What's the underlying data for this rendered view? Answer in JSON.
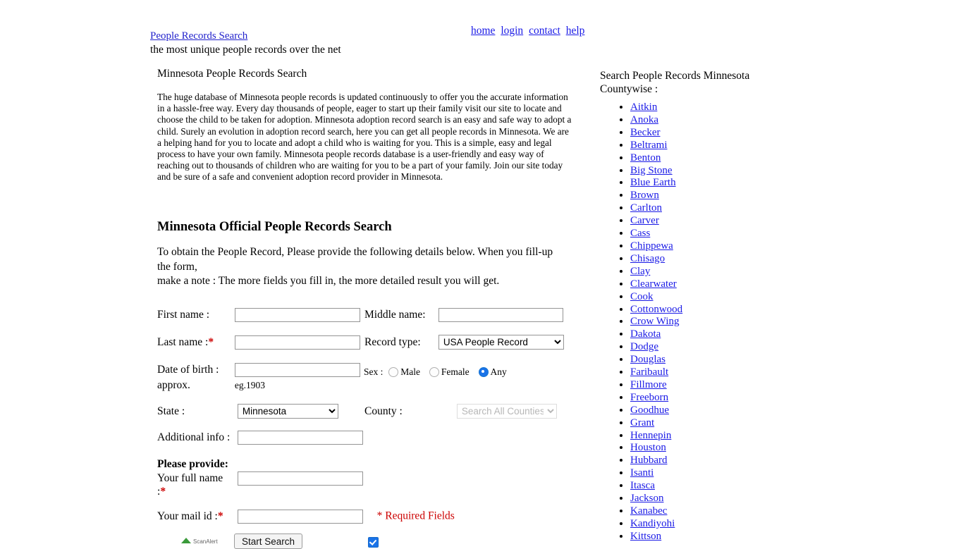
{
  "header": {
    "brand": "People Records Search",
    "tagline": "the most unique people records over the net",
    "nav": [
      {
        "label": "home"
      },
      {
        "label": "login"
      },
      {
        "label": "contact"
      },
      {
        "label": "help"
      }
    ]
  },
  "main": {
    "page_heading": "Minnesota People Records Search",
    "intro": "The huge database of Minnesota people records is updated continuously to offer you the accurate information in a hassle-free way. Every day thousands of people, eager to start up their family visit our site to locate and choose the child to be taken for adoption. Minnesota adoption record search is an easy and safe way to adopt a child. Surely an evolution in adoption record search, here you can get all people records in Minnesota. We are a helping hand for you to locate and adopt a child who is waiting for you. This is a simple, easy and legal process to have your own family. Minnesota people records database is a user-friendly and easy way of reaching out to thousands of children who are waiting for you to be a part of your family. Join our site today and be sure of a safe and convenient adoption record provider in Minnesota.",
    "form_heading": "Minnesota Official People Records Search",
    "instructions_line1": "To obtain the People Record, Please provide the following details below. When you fill-up the form,",
    "instructions_line2": "make a note : The more fields you fill in, the more detailed result you will get."
  },
  "form": {
    "first_name_label": "First name :",
    "first_name_value": "",
    "middle_name_label": "Middle name:",
    "middle_name_value": "",
    "last_name_label": "Last name :",
    "last_name_value": "",
    "record_type_label": "Record type:",
    "record_type_value": "USA People Record",
    "record_type_options": [
      "USA People Record"
    ],
    "dob_label": "Date of birth :",
    "dob_label_line2": "approx.",
    "dob_value": "",
    "dob_hint": "eg.1903",
    "sex_label": "Sex :",
    "sex_options": [
      {
        "label": "Male",
        "selected": false
      },
      {
        "label": "Female",
        "selected": false
      },
      {
        "label": "Any",
        "selected": true
      }
    ],
    "state_label": "State :",
    "state_value": "Minnesota",
    "state_options": [
      "Minnesota"
    ],
    "county_label": "County :",
    "county_value": "Search All Counties",
    "county_options": [
      "Search All Counties"
    ],
    "county_disabled": true,
    "additional_info_label": "Additional info :",
    "additional_info_value": "",
    "please_provide_label": "Please provide:",
    "full_name_label": "Your full name",
    "full_name_label_line2": ":",
    "full_name_value": "",
    "mail_id_label": "Your mail id :",
    "mail_id_value": "",
    "required_note": "* Required Fields",
    "required_marker": "*",
    "submit_label": "Start Search",
    "scanalert_label": "ScanAlert",
    "accent_blue": "#1a73e8",
    "required_red": "#cc0000"
  },
  "sidebar": {
    "title_line1": "Search People Records Minnesota",
    "title_line2": "Countywise :",
    "counties": [
      "Aitkin",
      "Anoka",
      "Becker",
      "Beltrami",
      "Benton",
      "Big Stone",
      "Blue Earth",
      "Brown",
      "Carlton",
      "Carver",
      "Cass",
      "Chippewa",
      "Chisago",
      "Clay",
      "Clearwater",
      "Cook",
      "Cottonwood",
      "Crow Wing",
      "Dakota",
      "Dodge",
      "Douglas",
      "Faribault",
      "Fillmore",
      "Freeborn",
      "Goodhue",
      "Grant",
      "Hennepin",
      "Houston",
      "Hubbard",
      "Isanti",
      "Itasca",
      "Jackson",
      "Kanabec",
      "Kandiyohi",
      "Kittson"
    ]
  }
}
